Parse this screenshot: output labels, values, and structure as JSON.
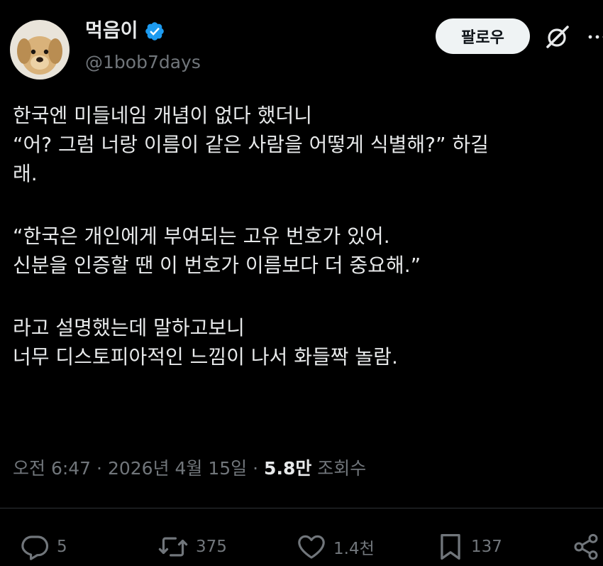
{
  "author": {
    "display_name": "먹음이",
    "handle": "@1bob7days",
    "verified": true,
    "avatar_icon": "puppy-avatar"
  },
  "header": {
    "follow_label": "팔로우",
    "grok_icon": "grok-icon",
    "more_icon": "more-dots-icon"
  },
  "tweet": {
    "paragraphs": [
      [
        "한국엔 미들네임 개념이 없다 했더니",
        "“어? 그럼 너랑 이름이 같은 사람을 어떻게 식별해?” 하길",
        "래."
      ],
      [
        "“한국은 개인에게 부여되는 고유 번호가 있어.",
        "신분을 인증할 땐 이 번호가 이름보다 더 중요해.”"
      ],
      [
        "라고 설명했는데 말하고보니",
        "너무 디스토피아적인 느낌이 나서 화들짝 놀람."
      ]
    ]
  },
  "meta": {
    "time": "오전 6:47",
    "separator": "·",
    "date": "2026년 4월 15일",
    "views_count": "5.8만",
    "views_label": "조회수"
  },
  "actions": {
    "replies": "5",
    "reposts": "375",
    "likes": "1.4천",
    "bookmarks": "137"
  },
  "colors": {
    "background": "#000000",
    "text": "#e7e9ea",
    "secondary_text": "#71767b",
    "verified_blue": "#1d9bf0",
    "follow_button_bg": "#eff3f4",
    "divider": "#2f3336"
  }
}
